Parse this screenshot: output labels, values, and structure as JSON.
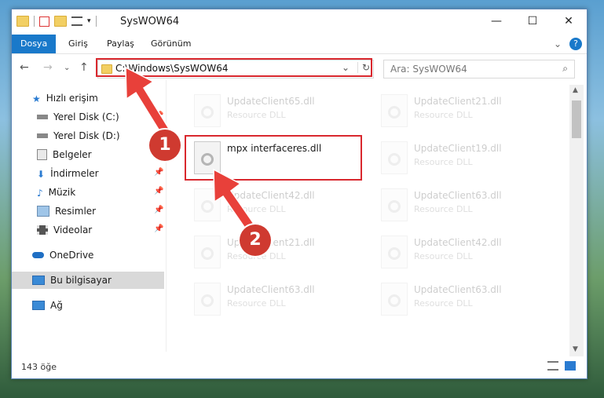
{
  "window": {
    "title": "SysWOW64",
    "controls": {
      "minimize": "—",
      "maximize": "☐",
      "close": "✕"
    }
  },
  "ribbon": {
    "tabs": [
      {
        "label": "Dosya",
        "active": true
      },
      {
        "label": "Giriş"
      },
      {
        "label": "Paylaş"
      },
      {
        "label": "Görünüm"
      }
    ],
    "help": "?"
  },
  "address": {
    "path": "C:\\Windows\\SysWOW64",
    "search_placeholder": "Ara: SysWOW64"
  },
  "nav": {
    "items": [
      {
        "label": "Hızlı erişim",
        "icon": "star-icon"
      },
      {
        "label": "Yerel Disk (C:)",
        "icon": "drive-icon",
        "pinned": true
      },
      {
        "label": "Yerel Disk (D:)",
        "icon": "drive-icon",
        "pinned": true
      },
      {
        "label": "Belgeler",
        "icon": "documents-icon",
        "pinned": true
      },
      {
        "label": "İndirmeler",
        "icon": "download-icon",
        "pinned": true
      },
      {
        "label": "Müzik",
        "icon": "music-icon",
        "pinned": true
      },
      {
        "label": "Resimler",
        "icon": "pictures-icon",
        "pinned": true
      },
      {
        "label": "Videolar",
        "icon": "videos-icon",
        "pinned": true
      },
      {
        "label": "OneDrive",
        "icon": "cloud-icon"
      },
      {
        "label": "Bu bilgisayar",
        "icon": "computer-icon",
        "selected": true
      },
      {
        "label": "Ağ",
        "icon": "network-icon"
      }
    ]
  },
  "files": [
    {
      "name": "UpdateClient65.dll",
      "type": "Resource DLL",
      "faded": true
    },
    {
      "name": "UpdateClient21.dll",
      "type": "Resource DLL",
      "faded": true
    },
    {
      "name": "mpx interfaceres.dll",
      "type": "",
      "faded": false
    },
    {
      "name": "UpdateClient19.dll",
      "type": "Resource DLL",
      "faded": true
    },
    {
      "name": "UpdateClient42.dll",
      "type": "Resource DLL",
      "faded": true
    },
    {
      "name": "UpdateClient63.dll",
      "type": "Resource DLL",
      "faded": true
    },
    {
      "name": "UpdateClient21.dll",
      "type": "Resource DLL",
      "faded": true
    },
    {
      "name": "UpdateClient42.dll",
      "type": "Resource DLL",
      "faded": true
    },
    {
      "name": "UpdateClient63.dll",
      "type": "Resource DLL",
      "faded": true
    },
    {
      "name": "UpdateClient63.dll",
      "type": "Resource DLL",
      "faded": true
    }
  ],
  "status": {
    "count": "143 öğe"
  },
  "annotations": {
    "step1": "1",
    "step2": "2",
    "color": "#d9282e"
  }
}
